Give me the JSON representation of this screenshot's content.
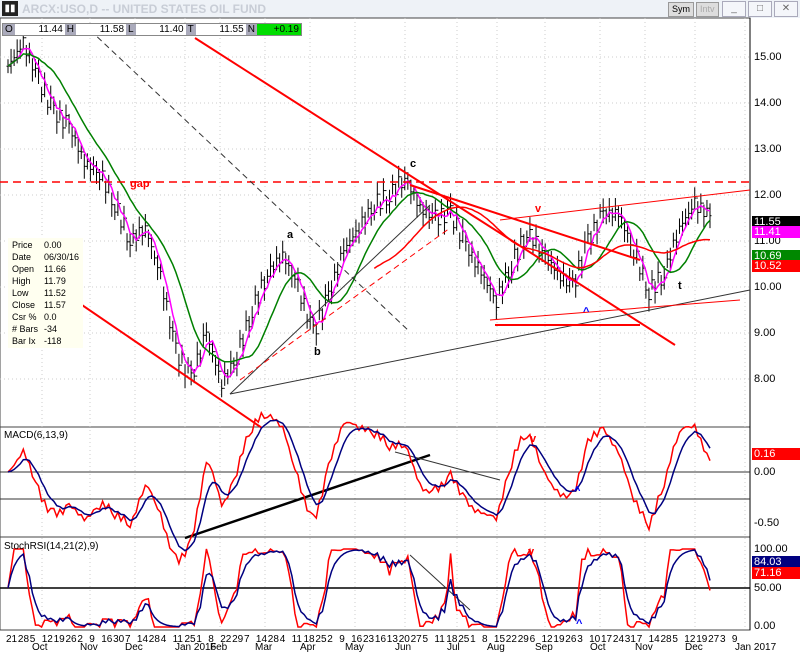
{
  "window": {
    "title": "ARCX:USO,D -- UNITED STATES OIL FUND",
    "sym_button": "Sym",
    "intv_button": "Intv",
    "minimize": "_",
    "maximize": "□",
    "close": "✕"
  },
  "ohlc": {
    "o_label": "O",
    "open": "11.44",
    "h_label": "H",
    "high": "11.58",
    "l_label": "L",
    "low": "11.40",
    "t_label": "T",
    "last": "11.55",
    "n_label": "N",
    "change": "+0.19"
  },
  "info": [
    [
      "Price",
      "0.00"
    ],
    [
      "Date",
      "06/30/16"
    ],
    [
      "Open",
      "11.66"
    ],
    [
      "High",
      "11.79"
    ],
    [
      "Low",
      "11.52"
    ],
    [
      "Close",
      "11.57"
    ],
    [
      "Csr %",
      "0.0"
    ],
    [
      "# Bars",
      "-34"
    ],
    [
      "Bar Ix",
      "-118"
    ]
  ],
  "price_axis": {
    "ticks": [
      "15.00",
      "14.00",
      "13.00",
      "12.00",
      "11.00",
      "10.00",
      "9.00",
      "8.00"
    ],
    "last": "11.55",
    "ma_fast": "11.41",
    "ma_mid": "10.69",
    "ma_slow": "10.52"
  },
  "macd": {
    "name": "MACD(6,13,9)",
    "ticks": [
      "0.00",
      "-0.50"
    ],
    "value": "0.16"
  },
  "stoch": {
    "name": "StochRSI(14,21(2),9)",
    "ticks": [
      "100.00",
      "50.00",
      "0.00"
    ],
    "value_blue": "84.03",
    "value_red": "71.16"
  },
  "annotations": {
    "gap": "gap",
    "a": "a",
    "b": "b",
    "c": "c",
    "v1": "v",
    "caret1": "^",
    "v2": "v",
    "caret2": "^",
    "v3": "v",
    "caret3": "^",
    "t": "t"
  },
  "colors": {
    "up": "#000000",
    "fast": "#ff00ff",
    "mid": "#008000",
    "slow": "#ff0000",
    "macd": "#ff0000",
    "signal": "#000080"
  },
  "xaxis": {
    "days": [
      "21",
      "28",
      "5",
      "12",
      "19",
      "26",
      "2",
      "9",
      "16",
      "30",
      "7",
      "14",
      "28",
      "4",
      "11",
      "25",
      "1",
      "8",
      "22",
      "29",
      "7",
      "14",
      "28",
      "4",
      "11",
      "18",
      "25",
      "2",
      "9",
      "16",
      "23",
      "16",
      "13",
      "20",
      "27",
      "5",
      "11",
      "18",
      "25",
      "1",
      "8",
      "15",
      "22",
      "29",
      "6",
      "12",
      "19",
      "26",
      "3",
      "10",
      "17",
      "24",
      "31",
      "7",
      "14",
      "28",
      "5",
      "12",
      "19",
      "27",
      "3",
      "9"
    ],
    "months": [
      "Oct",
      "Nov",
      "Dec",
      "Jan 2016",
      "Feb",
      "Mar",
      "Apr",
      "May",
      "Jun",
      "Jul",
      "Aug",
      "Sep",
      "Oct",
      "Nov",
      "Dec",
      "Jan 2017"
    ]
  },
  "chart_data": {
    "type": "line",
    "title": "ARCX:USO,D -- UNITED STATES OIL FUND",
    "xlabel": "",
    "ylabel": "Price",
    "ylim": [
      7.5,
      15.8
    ],
    "closes": [
      14.8,
      15.3,
      14.5,
      13.8,
      13.5,
      12.7,
      12.5,
      11.8,
      11.0,
      11.3,
      10.2,
      8.6,
      8.0,
      9.0,
      7.9,
      8.5,
      9.5,
      10.3,
      10.7,
      10.0,
      9.0,
      9.8,
      10.8,
      11.3,
      11.8,
      12.0,
      12.4,
      11.7,
      11.5,
      11.6,
      10.9,
      10.3,
      9.7,
      10.5,
      11.2,
      10.8,
      10.3,
      10.0,
      11.0,
      11.6,
      11.6,
      10.8,
      9.9,
      10.3,
      11.3,
      11.8,
      11.55
    ]
  }
}
